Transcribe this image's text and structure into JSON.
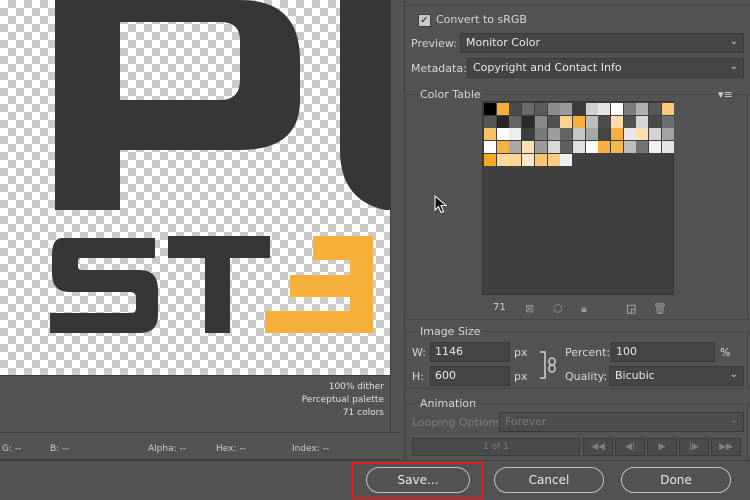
{
  "preview": {
    "info": [
      "100% dither",
      "Perceptual palette",
      "71 colors"
    ]
  },
  "status_bar": {
    "g": "G: --",
    "b": "B: --",
    "alpha": "Alpha: --",
    "hex": "Hex: --",
    "index": "Index: --"
  },
  "panel": {
    "convert_srgb_label": "Convert to sRGB",
    "convert_srgb_checked": true,
    "preview_label": "Preview:",
    "preview_value": "Monitor Color",
    "metadata_label": "Metadata:",
    "metadata_value": "Copyright and Contact Info",
    "color_table_title": "Color Table",
    "color_count": "71",
    "image_size_title": "Image Size",
    "width_label": "W:",
    "width_value": "1146",
    "height_label": "H:",
    "height_value": "600",
    "px": "px",
    "percent_label": "Percent:",
    "percent_value": "100",
    "percent_sign": "%",
    "quality_label": "Quality:",
    "quality_value": "Bicubic",
    "animation_title": "Animation",
    "looping_label": "Looping Options:",
    "looping_value": "Forever",
    "frame_counter": "1 of 1"
  },
  "buttons": {
    "save": "Save...",
    "cancel": "Cancel",
    "done": "Done"
  },
  "colors": {
    "accent_orange": "#f7b03a",
    "dark_letters": "#363636",
    "highlight_red": "#e21d1d"
  },
  "swatches": [
    [
      "#000000",
      "#f7b03a",
      "#4a4a4a",
      "#6a6a6a",
      "#5a5a5a",
      "#8c8c8c",
      "#9a9a9a",
      "#3a3a3a",
      "#cfcfcf",
      "#e6e6e6",
      "#ffffff",
      "#7b7b7b",
      "#b0b0b0",
      "#585858",
      "#fac977"
    ],
    [
      "#555555",
      "#262626",
      "#656565",
      "#2a2a2a",
      "#8a8a8a",
      "#4f4f4f",
      "#ffd190",
      "#f7b03a",
      "#bdbdbd",
      "#4c4c4c",
      "#fbdcab",
      "#505050",
      "#d5d5d5",
      "#4a4a4a",
      "#6e6e6e"
    ],
    [
      "#f9c065",
      "#ffffff",
      "#ededed",
      "#3e3e3e",
      "#7a7a7a",
      "#9d9d9d",
      "#636363",
      "#c7c7c7",
      "#a8a8a8",
      "#454545",
      "#f7b03a",
      "#e8e8e8",
      "#fddfb4",
      "#d2d2d2",
      "#a3a3a3"
    ],
    [
      "#ffffff",
      "#f5b142",
      "#a8a8a8",
      "#fddfb4",
      "#9c9c9c",
      "#d9d9d9",
      "#5f5f5f",
      "#e0e0e0",
      "#ffffff",
      "#f7b03a",
      "#f9b84e",
      "#bdbdbd",
      "#727272",
      "#f2f2f2",
      "#e5e5e5"
    ],
    [
      "#f7a825",
      "#ffd89c",
      "#fcd399",
      "#ffe8c6",
      "#fbc473",
      "#fbcc85",
      "#f0f0f0"
    ]
  ]
}
